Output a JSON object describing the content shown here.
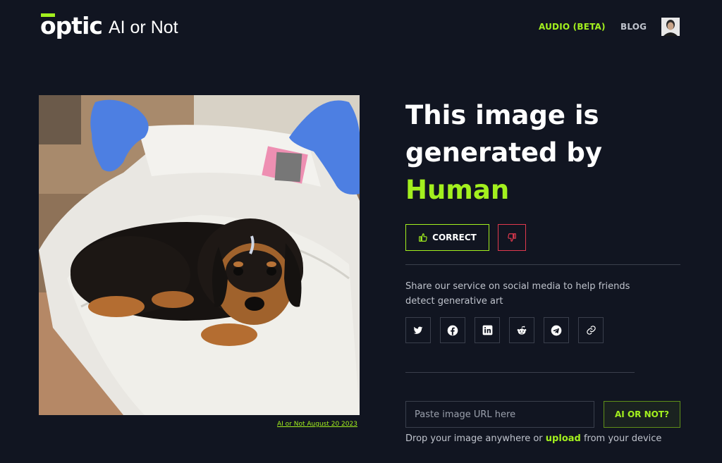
{
  "header": {
    "logo_brand": "optic",
    "logo_product": "AI or Not",
    "nav": {
      "audio_label": "AUDIO (BETA)",
      "blog_label": "BLOG"
    }
  },
  "image": {
    "caption": "AI or Not August 20 2023"
  },
  "result": {
    "line1": "This image is",
    "line2": "generated by",
    "verdict": "Human",
    "correct_label": "CORRECT"
  },
  "share": {
    "text": "Share our service on social media to help friends detect generative art",
    "icons": [
      "twitter-icon",
      "facebook-icon",
      "linkedin-icon",
      "reddit-icon",
      "telegram-icon",
      "link-icon"
    ]
  },
  "upload": {
    "url_placeholder": "Paste image URL here",
    "submit_label": "AI OR NOT?",
    "drop_prefix": "Drop your image anywhere or",
    "upload_link": "upload",
    "drop_suffix": "from your device"
  },
  "colors": {
    "background": "#111521",
    "accent": "#a3f01e",
    "danger": "#e0394e",
    "border": "#3a3f4c"
  }
}
